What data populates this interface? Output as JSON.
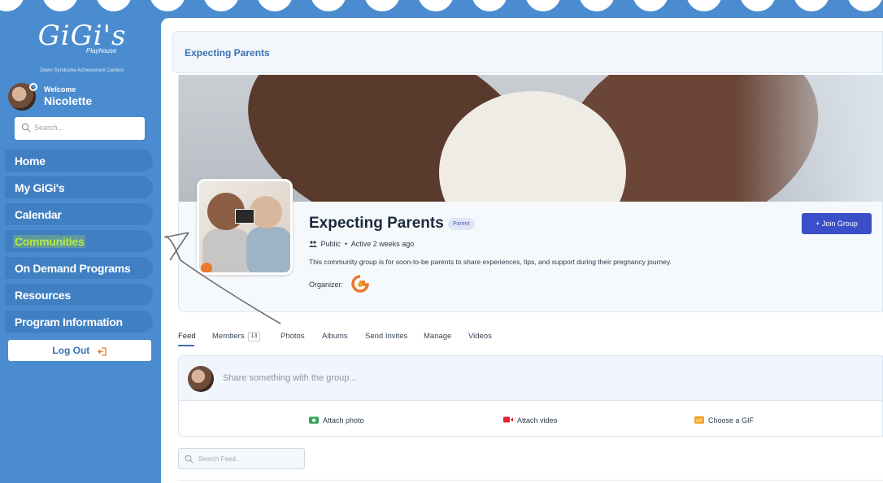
{
  "logo": {
    "mark": "GiGi's",
    "sub": "Playhouse",
    "tagline": "Down Syndrome Achievement Centers"
  },
  "user": {
    "welcome": "Welcome",
    "name": "Nicolette"
  },
  "sidebar": {
    "search_placeholder": "Search...",
    "items": [
      {
        "label": "Home"
      },
      {
        "label": "My GiGi's"
      },
      {
        "label": "Calendar"
      },
      {
        "label": "Communities",
        "active": true
      },
      {
        "label": "On Demand Programs"
      },
      {
        "label": "Resources"
      },
      {
        "label": "Program Information"
      }
    ],
    "logout": "Log Out"
  },
  "header": {
    "title": "Expecting Parents"
  },
  "group": {
    "name": "Expecting Parents",
    "badge": "Parent",
    "visibility": "Public",
    "activity": "Active 2 weeks ago",
    "description": "This community group is for soon-to-be parents to share experiences, tips, and support during their pregnancy journey.",
    "organizer_label": "Organizer:",
    "join_label": "+ Join Group"
  },
  "tabs": [
    {
      "label": "Feed",
      "active": true
    },
    {
      "label": "Members",
      "count": "13"
    },
    {
      "label": "Photos"
    },
    {
      "label": "Albums"
    },
    {
      "label": "Send Invites"
    },
    {
      "label": "Manage"
    },
    {
      "label": "Videos"
    }
  ],
  "composer": {
    "placeholder": "Share something with the group...",
    "actions": [
      {
        "label": "Attach photo",
        "icon": "camera-icon",
        "color": "#3aa15a"
      },
      {
        "label": "Attach video",
        "icon": "video-icon",
        "color": "#e0243a"
      },
      {
        "label": "Choose a GIF",
        "icon": "gif-icon",
        "color": "#f2a524"
      }
    ]
  },
  "feed_search": {
    "placeholder": "Search Feed..."
  },
  "colors": {
    "sidebar_bg": "#4a8ccf",
    "nav_item": "#3f7fc2",
    "active_highlight": "#b6e84a",
    "join_button": "#3a4fc8",
    "brand_orange": "#e9792b"
  }
}
